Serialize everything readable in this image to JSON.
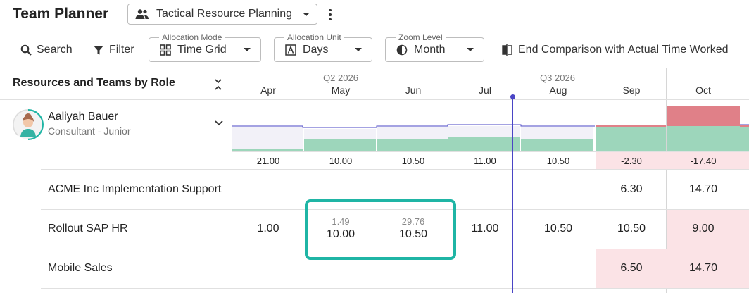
{
  "header": {
    "title": "Team Planner",
    "planner_select": "Tactical Resource Planning"
  },
  "toolbar": {
    "search_label": "Search",
    "filter_label": "Filter",
    "allocation_mode": {
      "legend": "Allocation Mode",
      "value": "Time Grid"
    },
    "allocation_unit": {
      "legend": "Allocation Unit",
      "value": "Days"
    },
    "zoom_level": {
      "legend": "Zoom Level",
      "value": "Month"
    },
    "end_comparison_label": "End Comparison with Actual Time Worked"
  },
  "grid": {
    "resources_header": "Resources and Teams by Role",
    "quarters": [
      "Q2 2026",
      "Q3 2026"
    ],
    "months": [
      "Apr",
      "May",
      "Jun",
      "Jul",
      "Aug",
      "Sep",
      "Oct"
    ]
  },
  "resource": {
    "name": "Aaliyah Bauer",
    "role": "Consultant - Junior",
    "totals": [
      "21.00",
      "10.00",
      "10.50",
      "11.00",
      "10.50",
      "-2.30",
      "-17.40"
    ]
  },
  "tasks": [
    {
      "name": "ACME Inc Implementation Support",
      "values": [
        "",
        "",
        "",
        "",
        "",
        "6.30",
        "14.70"
      ]
    },
    {
      "name": "Rollout SAP HR",
      "values": [
        "1.00",
        "10.00",
        "10.50",
        "11.00",
        "10.50",
        "10.50",
        "9.00"
      ],
      "actuals": [
        "",
        "1.49",
        "29.76",
        "",
        "",
        "",
        ""
      ]
    },
    {
      "name": "Mobile Sales",
      "values": [
        "",
        "",
        "",
        "",
        "",
        "6.50",
        "14.70"
      ]
    }
  ],
  "colors": {
    "allocation_green": "#9dd6bb",
    "over_red": "#e08088",
    "negative_bg": "#fbe3e6",
    "today_line": "#4a45c5",
    "highlight": "#1fb5a5"
  }
}
